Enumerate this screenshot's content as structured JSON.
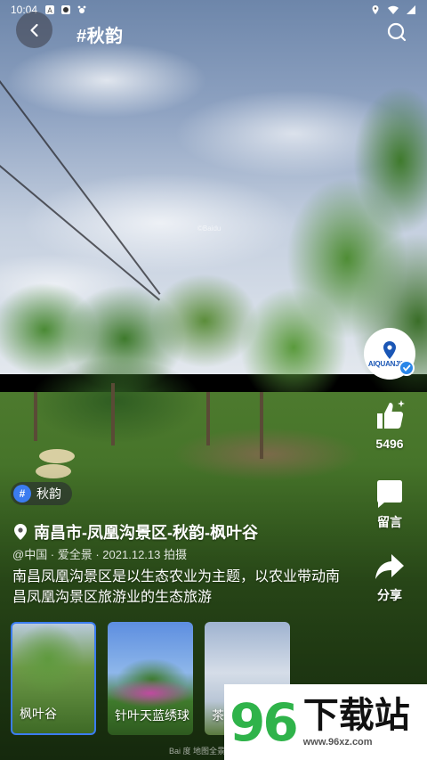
{
  "status_bar": {
    "time": "10:04"
  },
  "header": {
    "title": "#秋韵"
  },
  "author": {
    "avatar_text": "AIQUANJING"
  },
  "actions": {
    "like_count": "5496",
    "comment_label": "留言",
    "share_label": "分享"
  },
  "post": {
    "tag": "秋韵",
    "location": "南昌市-凤凰沟景区-秋韵-枫叶谷",
    "meta": "@中国 · 爱全景 · 2021.12.13 拍摄",
    "description": "南昌凤凰沟景区是以生态农业为主题，以农业带动南昌凤凰沟景区旅游业的生态旅游"
  },
  "thumbnails": [
    {
      "label": "枫叶谷",
      "active": true
    },
    {
      "label": "针叶天蓝绣球",
      "active": false
    },
    {
      "label": "茶",
      "active": false
    }
  ],
  "watermarks": {
    "brand_number": "96",
    "brand_text": "下载站",
    "brand_url": "www.96xz.com",
    "baidu_top": "©Baidu",
    "baidu_bottom": "Bai 度 地图全景"
  },
  "colors": {
    "accent": "#3b7cf0",
    "brand_green": "#2fb34a",
    "verified": "#2a86e8"
  }
}
